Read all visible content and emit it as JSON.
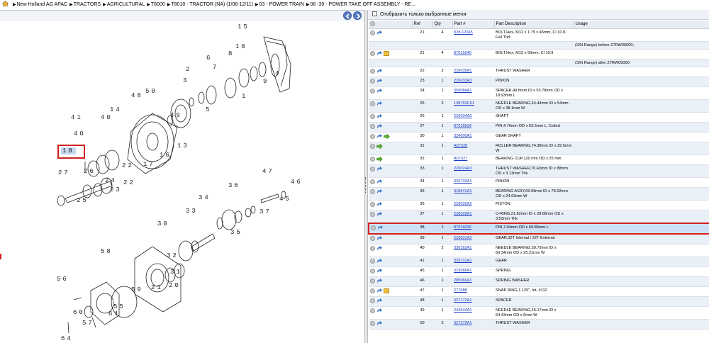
{
  "breadcrumb": [
    "New Holland AG APAC",
    "TRACTORS",
    "AGRICULTURAL",
    "T8000",
    "T8010 - TRACTOR (NA) (1/06-12/11)",
    "03 - POWER TRAIN",
    "06 -39 - POWER TAKE OFF ASSEMBLY - RE..."
  ],
  "filter_label": "Отобразить только выбранные метки",
  "columns": [
    "",
    "Ref",
    "Qty",
    "Part #",
    "Part Description",
    "Usage"
  ],
  "rows": [
    {
      "icons": [
        "grey",
        "blue"
      ],
      "ref": "21",
      "qty": "4",
      "part": "828-12045",
      "desc": "BOLT,Hex, M12 x 1.75 x 45mm, Cl 10.9, Full Thd",
      "usage": ""
    },
    {
      "icons": [],
      "ref": "",
      "qty": "",
      "part": "",
      "desc": "",
      "usage": "(S/N Range) before Z7RW05000;"
    },
    {
      "icons": [
        "grey",
        "blue",
        "note"
      ],
      "ref": "21",
      "qty": "4",
      "part": "87015540",
      "desc": "BOLT,Hex, M12 x 50mm, Cl 10.9",
      "usage": ""
    },
    {
      "icons": [],
      "ref": "",
      "qty": "",
      "part": "",
      "desc": "",
      "usage": "(S/N Range) after Z7RW05000;"
    },
    {
      "icons": [
        "grey",
        "blue"
      ],
      "ref": "22",
      "qty": "2",
      "part": "226035A1",
      "desc": "THRUST WASHER",
      "usage": ""
    },
    {
      "icons": [
        "grey",
        "blue"
      ],
      "ref": "23",
      "qty": "1",
      "part": "226033A3",
      "desc": "PINION",
      "usage": ""
    },
    {
      "icons": [
        "grey",
        "blue"
      ],
      "ref": "24",
      "qty": "1",
      "part": "350084A1",
      "desc": "SPACER,49.8mm ID x 53.78mm OD x 18.93mm L",
      "usage": ""
    },
    {
      "icons": [
        "grey",
        "blue"
      ],
      "ref": "25",
      "qty": "2",
      "part": "138763C91",
      "desc": "NEEDLE BEARING,44.44mm ID x 54mm OD x 38.1mm W",
      "usage": ""
    },
    {
      "icons": [
        "grey",
        "blue"
      ],
      "ref": "26",
      "qty": "1",
      "part": "226034A2",
      "desc": "SHAFT",
      "usage": ""
    },
    {
      "icons": [
        "grey",
        "blue"
      ],
      "ref": "27",
      "qty": "1",
      "part": "87016634",
      "desc": "PIN,4.76mm OD x 63.5mm L, Coiled",
      "usage": ""
    },
    {
      "icons": [
        "grey",
        "blue",
        "green"
      ],
      "ref": "30",
      "qty": "1",
      "part": "324000A1",
      "desc": "GEAR SHAFT",
      "usage": ""
    },
    {
      "icons": [
        "grey",
        "green"
      ],
      "ref": "31",
      "qty": "1",
      "part": "A67328",
      "desc": "ROLLER BEARING,74.98mm ID x 29.5mm W",
      "usage": ""
    },
    {
      "icons": [
        "grey",
        "green"
      ],
      "ref": "32",
      "qty": "1",
      "part": "A67327",
      "desc": "BEARING CUP,120 mm OD x 25 mm",
      "usage": ""
    },
    {
      "icons": [
        "grey",
        "blue"
      ],
      "ref": "33",
      "qty": "1",
      "part": "226024A3",
      "desc": "THRUST WASHER,70.43mm ID x 88mm OD x 3.13mm Thk",
      "usage": ""
    },
    {
      "icons": [
        "grey",
        "blue"
      ],
      "ref": "34",
      "qty": "1",
      "part": "326733A1",
      "desc": "PINION",
      "usage": ""
    },
    {
      "icons": [
        "grey",
        "blue"
      ],
      "ref": "35",
      "qty": "1",
      "part": "318641A1",
      "desc": "BEARING ASSY,69.99mm ID x 78.02mm OD x 24.63mm W",
      "usage": ""
    },
    {
      "icons": [
        "grey",
        "blue"
      ],
      "ref": "36",
      "qty": "1",
      "part": "226026A2",
      "desc": "PISTON",
      "usage": ""
    },
    {
      "icons": [
        "grey",
        "blue"
      ],
      "ref": "37",
      "qty": "1",
      "part": "226029A1",
      "desc": "O-RING,21.82mm ID x 28.88mm OD x 3.53mm Thk",
      "usage": ""
    },
    {
      "icons": [
        "grey",
        "blue"
      ],
      "ref": "38",
      "qty": "1",
      "part": "87016636",
      "desc": "PIN,7.94mm OD x 69.85mm L",
      "usage": "",
      "selected": true
    },
    {
      "icons": [
        "grey",
        "blue"
      ],
      "ref": "39",
      "qty": "1",
      "part": "226031A2",
      "desc": "GEAR,32T Internal / 22T External",
      "usage": ""
    },
    {
      "icons": [
        "grey",
        "blue"
      ],
      "ref": "40",
      "qty": "2",
      "part": "330162A1",
      "desc": "NEEDLE BEARING,50.79mm ID x 60.34mm OD x 25.21mm W",
      "usage": ""
    },
    {
      "icons": [
        "grey",
        "blue"
      ],
      "ref": "41",
      "qty": "1",
      "part": "326731A1",
      "desc": "GEAR",
      "usage": ""
    },
    {
      "icons": [
        "grey",
        "blue"
      ],
      "ref": "45",
      "qty": "1",
      "part": "323066A1",
      "desc": "SPRING",
      "usage": ""
    },
    {
      "icons": [
        "grey",
        "blue"
      ],
      "ref": "46",
      "qty": "1",
      "part": "285066A1",
      "desc": "SPRING WASHER",
      "usage": ""
    },
    {
      "icons": [
        "grey",
        "blue",
        "note"
      ],
      "ref": "47",
      "qty": "1",
      "part": "277688",
      "desc": "SNAP RING,1.125\", Int, #112",
      "usage": ""
    },
    {
      "icons": [
        "grey",
        "blue"
      ],
      "ref": "48",
      "qty": "1",
      "part": "327172A1",
      "desc": "SPACER",
      "usage": ""
    },
    {
      "icons": [
        "grey",
        "blue"
      ],
      "ref": "49",
      "qty": "1",
      "part": "243544A1",
      "desc": "NEEDLE BEARING,45.17mm ID x 64.43mm OD x 6mm W",
      "usage": ""
    },
    {
      "icons": [
        "grey",
        "blue"
      ],
      "ref": "50",
      "qty": "2",
      "part": "327372A1",
      "desc": "THRUST WASHER",
      "usage": ""
    }
  ],
  "callouts": [
    {
      "n": "15"
    },
    {
      "n": "10"
    },
    {
      "n": "8"
    },
    {
      "n": "6"
    },
    {
      "n": "7"
    },
    {
      "n": "9"
    },
    {
      "n": "4"
    },
    {
      "n": "2"
    },
    {
      "n": "3"
    },
    {
      "n": "5"
    },
    {
      "n": "1"
    },
    {
      "n": "50"
    },
    {
      "n": "48"
    },
    {
      "n": "49"
    },
    {
      "n": "14"
    },
    {
      "n": "13"
    },
    {
      "n": "41"
    },
    {
      "n": "40"
    },
    {
      "n": "16"
    },
    {
      "n": "17"
    },
    {
      "n": "40"
    },
    {
      "n": "39"
    },
    {
      "n": "27"
    },
    {
      "n": "26"
    },
    {
      "n": "22"
    },
    {
      "n": "24"
    },
    {
      "n": "23"
    },
    {
      "n": "22"
    },
    {
      "n": "25"
    },
    {
      "n": "47"
    },
    {
      "n": "46"
    },
    {
      "n": "45"
    },
    {
      "n": "36"
    },
    {
      "n": "34"
    },
    {
      "n": "33"
    },
    {
      "n": "37"
    },
    {
      "n": "30"
    },
    {
      "n": "35"
    },
    {
      "n": "58"
    },
    {
      "n": "31"
    },
    {
      "n": "32"
    },
    {
      "n": "20"
    },
    {
      "n": "21"
    },
    {
      "n": "56"
    },
    {
      "n": "59"
    },
    {
      "n": "55"
    },
    {
      "n": "61"
    },
    {
      "n": "60"
    },
    {
      "n": "57"
    },
    {
      "n": "64"
    }
  ],
  "selected_callout": "18"
}
